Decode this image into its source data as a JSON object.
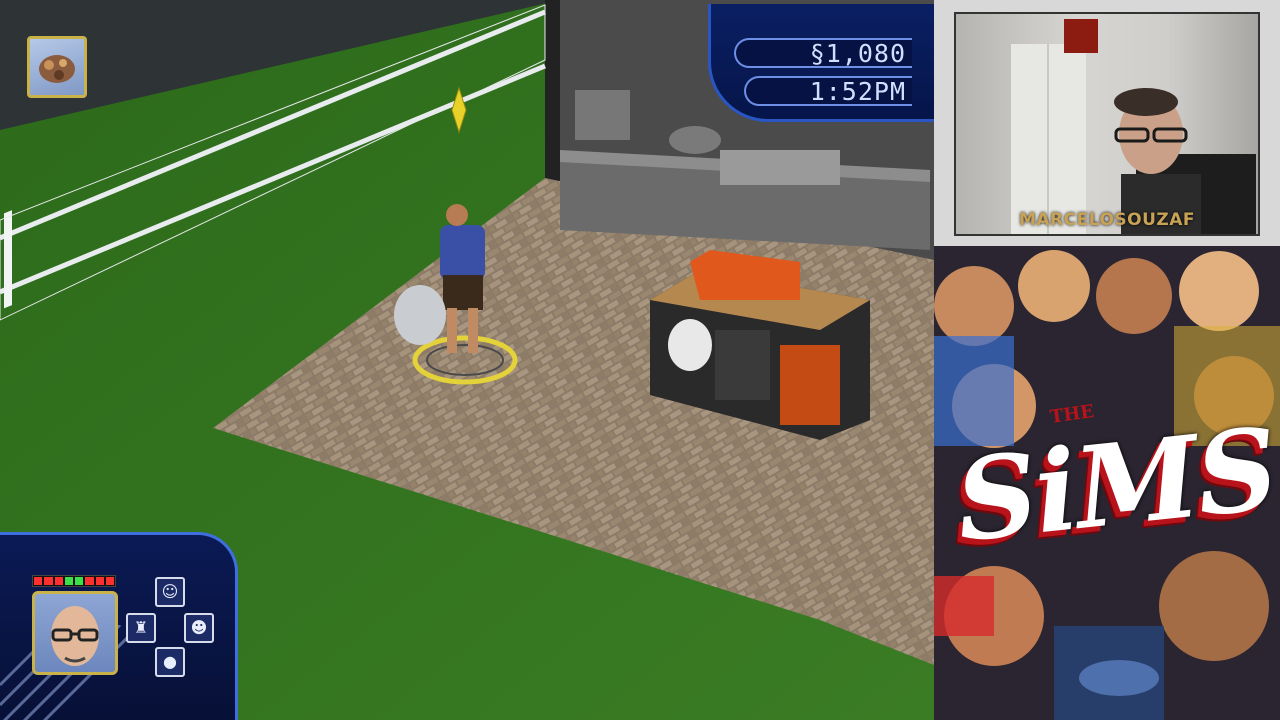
{
  "hud": {
    "funds": "§1,080",
    "clock": "1:52PM"
  },
  "mood_icon": "thought-bubble-icon",
  "sim_panel": {
    "controls": [
      "comedy-drama-masks-icon",
      "build-mode-icon",
      "family-icon",
      "head-profile-icon"
    ]
  },
  "webcam": {
    "streamer_name": "MARCELOSOUZAF"
  },
  "cover": {
    "title": "SiMS"
  },
  "colors": {
    "lawn": "#2f6b1d",
    "hud_blue": "#0a1f63",
    "plumbob": "#e8d22a",
    "grill_orange": "#e0581c"
  }
}
